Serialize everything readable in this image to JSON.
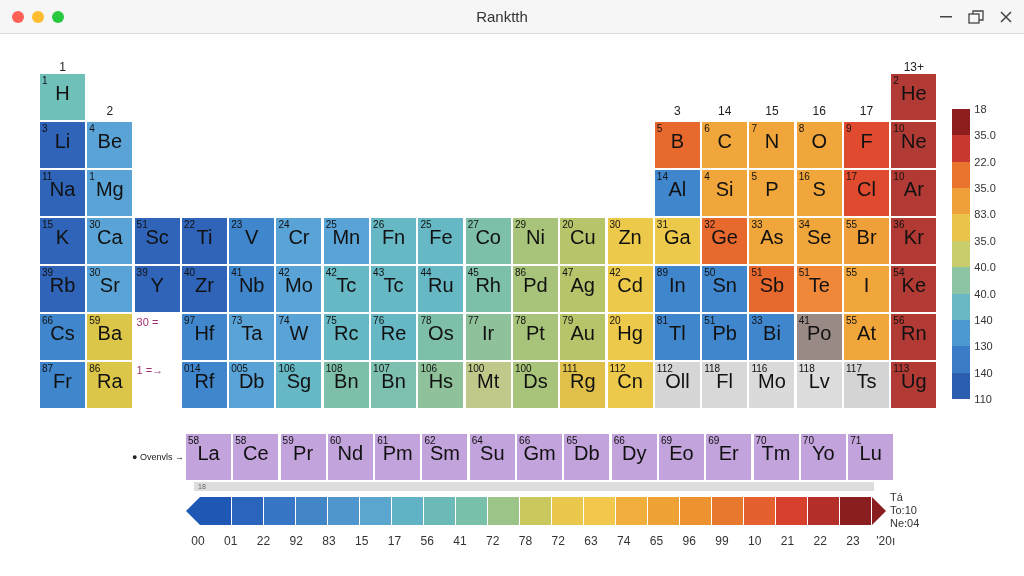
{
  "window": {
    "title": "Ranktth"
  },
  "periodic_table": {
    "header_labels": [
      {
        "kind": "label",
        "text": "1"
      },
      {
        "kind": "empty"
      },
      {
        "kind": "empty"
      },
      {
        "kind": "empty"
      },
      {
        "kind": "empty"
      },
      {
        "kind": "empty"
      },
      {
        "kind": "empty"
      },
      {
        "kind": "empty"
      },
      {
        "kind": "empty"
      },
      {
        "kind": "empty"
      },
      {
        "kind": "empty"
      },
      {
        "kind": "empty"
      },
      {
        "kind": "empty"
      },
      {
        "kind": "empty"
      },
      {
        "kind": "empty"
      },
      {
        "kind": "empty"
      },
      {
        "kind": "empty"
      },
      {
        "kind": "empty"
      },
      {
        "kind": "label",
        "text": "13+"
      }
    ],
    "rows": [
      [
        {
          "kind": "element",
          "number": "1",
          "symbol": "H",
          "color": "#6fc0b8"
        },
        {
          "kind": "label",
          "text": "2"
        },
        {
          "kind": "empty"
        },
        {
          "kind": "empty"
        },
        {
          "kind": "empty"
        },
        {
          "kind": "empty"
        },
        {
          "kind": "empty"
        },
        {
          "kind": "empty"
        },
        {
          "kind": "empty"
        },
        {
          "kind": "empty"
        },
        {
          "kind": "empty"
        },
        {
          "kind": "empty"
        },
        {
          "kind": "empty"
        },
        {
          "kind": "label",
          "text": "3"
        },
        {
          "kind": "label",
          "text": "14"
        },
        {
          "kind": "label",
          "text": "15"
        },
        {
          "kind": "label",
          "text": "16"
        },
        {
          "kind": "label",
          "text": "17"
        },
        {
          "kind": "element",
          "number": "2",
          "symbol": "He",
          "color": "#b23a35"
        }
      ],
      [
        {
          "kind": "element",
          "number": "3",
          "symbol": "Li",
          "color": "#2f64b8"
        },
        {
          "kind": "element",
          "number": "4",
          "symbol": "Be",
          "color": "#5aa3d6"
        },
        {
          "kind": "empty"
        },
        {
          "kind": "empty"
        },
        {
          "kind": "empty"
        },
        {
          "kind": "empty"
        },
        {
          "kind": "empty"
        },
        {
          "kind": "empty"
        },
        {
          "kind": "empty"
        },
        {
          "kind": "empty"
        },
        {
          "kind": "empty"
        },
        {
          "kind": "empty"
        },
        {
          "kind": "empty"
        },
        {
          "kind": "element",
          "number": "5",
          "symbol": "B",
          "color": "#e8692e"
        },
        {
          "kind": "element",
          "number": "6",
          "symbol": "C",
          "color": "#f0a63a"
        },
        {
          "kind": "element",
          "number": "7",
          "symbol": "N",
          "color": "#f0a63a"
        },
        {
          "kind": "element",
          "number": "8",
          "symbol": "O",
          "color": "#f0a63a"
        },
        {
          "kind": "element",
          "number": "9",
          "symbol": "F",
          "color": "#e04a2e"
        },
        {
          "kind": "element",
          "number": "10",
          "symbol": "Ne",
          "color": "#b23a35"
        }
      ],
      [
        {
          "kind": "element",
          "number": "11",
          "symbol": "Na",
          "color": "#2f64b8"
        },
        {
          "kind": "element",
          "number": "1",
          "symbol": "Mg",
          "color": "#5aa3d6"
        },
        {
          "kind": "empty"
        },
        {
          "kind": "empty"
        },
        {
          "kind": "empty"
        },
        {
          "kind": "empty"
        },
        {
          "kind": "empty"
        },
        {
          "kind": "empty"
        },
        {
          "kind": "empty"
        },
        {
          "kind": "empty"
        },
        {
          "kind": "empty"
        },
        {
          "kind": "empty"
        },
        {
          "kind": "empty"
        },
        {
          "kind": "element",
          "number": "14",
          "symbol": "Al",
          "color": "#3f86cc"
        },
        {
          "kind": "element",
          "number": "4",
          "symbol": "Si",
          "color": "#f0a63a"
        },
        {
          "kind": "element",
          "number": "5",
          "symbol": "P",
          "color": "#f0a63a"
        },
        {
          "kind": "element",
          "number": "16",
          "symbol": "S",
          "color": "#f0a63a"
        },
        {
          "kind": "element",
          "number": "17",
          "symbol": "Cl",
          "color": "#e04a2e"
        },
        {
          "kind": "element",
          "number": "10",
          "symbol": "Ar",
          "color": "#b23a35"
        }
      ],
      [
        {
          "kind": "element",
          "number": "15",
          "symbol": "K",
          "color": "#2f64b8"
        },
        {
          "kind": "element",
          "number": "30",
          "symbol": "Ca",
          "color": "#5aa3d6"
        },
        {
          "kind": "element",
          "number": "51",
          "symbol": "Sc",
          "color": "#2f64b8"
        },
        {
          "kind": "element",
          "number": "22",
          "symbol": "Ti",
          "color": "#2f64b8"
        },
        {
          "kind": "element",
          "number": "23",
          "symbol": "V",
          "color": "#3f86cc"
        },
        {
          "kind": "element",
          "number": "24",
          "symbol": "Cr",
          "color": "#5aa3d6"
        },
        {
          "kind": "element",
          "number": "25",
          "symbol": "Mn",
          "color": "#5aa3d6"
        },
        {
          "kind": "element",
          "number": "26",
          "symbol": "Fn",
          "color": "#66b8c4"
        },
        {
          "kind": "element",
          "number": "25",
          "symbol": "Fe",
          "color": "#66b8c4"
        },
        {
          "kind": "element",
          "number": "27",
          "symbol": "Co",
          "color": "#7dbfa8"
        },
        {
          "kind": "element",
          "number": "29",
          "symbol": "Ni",
          "color": "#a8c47a"
        },
        {
          "kind": "element",
          "number": "20",
          "symbol": "Cu",
          "color": "#b8c46a"
        },
        {
          "kind": "element",
          "number": "30",
          "symbol": "Zn",
          "color": "#ecc94b"
        },
        {
          "kind": "element",
          "number": "31",
          "symbol": "Ga",
          "color": "#ecc94b"
        },
        {
          "kind": "element",
          "number": "32",
          "symbol": "Ge",
          "color": "#e8692e"
        },
        {
          "kind": "element",
          "number": "33",
          "symbol": "As",
          "color": "#f0a63a"
        },
        {
          "kind": "element",
          "number": "34",
          "symbol": "Se",
          "color": "#f0a63a"
        },
        {
          "kind": "element",
          "number": "55",
          "symbol": "Br",
          "color": "#f0a03a"
        },
        {
          "kind": "element",
          "number": "36",
          "symbol": "Kr",
          "color": "#b23a35"
        }
      ],
      [
        {
          "kind": "element",
          "number": "39",
          "symbol": "Rb",
          "color": "#2f64b8"
        },
        {
          "kind": "element",
          "number": "30",
          "symbol": "Sr",
          "color": "#5aa3d6"
        },
        {
          "kind": "element",
          "number": "39",
          "symbol": "Y",
          "color": "#2f64b8"
        },
        {
          "kind": "element",
          "number": "40",
          "symbol": "Zr",
          "color": "#2f64b8"
        },
        {
          "kind": "element",
          "number": "41",
          "symbol": "Nb",
          "color": "#3f86cc"
        },
        {
          "kind": "element",
          "number": "42",
          "symbol": "Mo",
          "color": "#5aa3d6"
        },
        {
          "kind": "element",
          "number": "42",
          "symbol": "Tc",
          "color": "#66b8c4"
        },
        {
          "kind": "element",
          "number": "43",
          "symbol": "Tc",
          "color": "#66b8c4"
        },
        {
          "kind": "element",
          "number": "44",
          "symbol": "Ru",
          "color": "#66b8c4"
        },
        {
          "kind": "element",
          "number": "45",
          "symbol": "Rh",
          "color": "#7dbfa8"
        },
        {
          "kind": "element",
          "number": "86",
          "symbol": "Pd",
          "color": "#a8c47a"
        },
        {
          "kind": "element",
          "number": "47",
          "symbol": "Ag",
          "color": "#b8c46a"
        },
        {
          "kind": "element",
          "number": "42",
          "symbol": "Cd",
          "color": "#ecc94b"
        },
        {
          "kind": "element",
          "number": "89",
          "symbol": "In",
          "color": "#3f86cc"
        },
        {
          "kind": "element",
          "number": "50",
          "symbol": "Sn",
          "color": "#3f86cc"
        },
        {
          "kind": "element",
          "number": "51",
          "symbol": "Sb",
          "color": "#e8692e"
        },
        {
          "kind": "element",
          "number": "51",
          "symbol": "Te",
          "color": "#f0883a"
        },
        {
          "kind": "element",
          "number": "55",
          "symbol": "I",
          "color": "#f0a63a"
        },
        {
          "kind": "element",
          "number": "54",
          "symbol": "Ke",
          "color": "#b23a35"
        }
      ],
      [
        {
          "kind": "element",
          "number": "66",
          "symbol": "Cs",
          "color": "#3f86cc"
        },
        {
          "kind": "element",
          "number": "59",
          "symbol": "Ba",
          "color": "#dcc64a"
        },
        {
          "kind": "label",
          "text": "30 ="
        },
        {
          "kind": "element",
          "number": "97",
          "symbol": "Hf",
          "color": "#3f86cc"
        },
        {
          "kind": "element",
          "number": "73",
          "symbol": "Ta",
          "color": "#5aa3d6"
        },
        {
          "kind": "element",
          "number": "74",
          "symbol": "W",
          "color": "#5aa3d6"
        },
        {
          "kind": "element",
          "number": "75",
          "symbol": "Rc",
          "color": "#66b8c4"
        },
        {
          "kind": "element",
          "number": "76",
          "symbol": "Re",
          "color": "#66b8c4"
        },
        {
          "kind": "element",
          "number": "78",
          "symbol": "Os",
          "color": "#7dbfa8"
        },
        {
          "kind": "element",
          "number": "77",
          "symbol": "Ir",
          "color": "#8fc29a"
        },
        {
          "kind": "element",
          "number": "78",
          "symbol": "Pt",
          "color": "#a8c47a"
        },
        {
          "kind": "element",
          "number": "79",
          "symbol": "Au",
          "color": "#b8c46a"
        },
        {
          "kind": "element",
          "number": "20",
          "symbol": "Hg",
          "color": "#ecc94b"
        },
        {
          "kind": "element",
          "number": "81",
          "symbol": "Tl",
          "color": "#3f86cc"
        },
        {
          "kind": "element",
          "number": "51",
          "symbol": "Pb",
          "color": "#3f86cc"
        },
        {
          "kind": "element",
          "number": "33",
          "symbol": "Bi",
          "color": "#3f86cc"
        },
        {
          "kind": "element",
          "number": "41",
          "symbol": "Po",
          "color": "#9a8a86"
        },
        {
          "kind": "element",
          "number": "55",
          "symbol": "At",
          "color": "#f0a63a"
        },
        {
          "kind": "element",
          "number": "56",
          "symbol": "Rn",
          "color": "#b23a35"
        }
      ],
      [
        {
          "kind": "element",
          "number": "87",
          "symbol": "Fr",
          "color": "#3f86cc"
        },
        {
          "kind": "element",
          "number": "86",
          "symbol": "Ra",
          "color": "#dcc64a"
        },
        {
          "kind": "label",
          "text": "1 =→"
        },
        {
          "kind": "element",
          "number": "014",
          "symbol": "Rf",
          "color": "#3f86cc"
        },
        {
          "kind": "element",
          "number": "005",
          "symbol": "Db",
          "color": "#5aa3d6"
        },
        {
          "kind": "element",
          "number": "106",
          "symbol": "Sg",
          "color": "#66b8c4"
        },
        {
          "kind": "element",
          "number": "108",
          "symbol": "Bn",
          "color": "#7dbfa8"
        },
        {
          "kind": "element",
          "number": "107",
          "symbol": "Bn",
          "color": "#7dc0b0"
        },
        {
          "kind": "element",
          "number": "106",
          "symbol": "Hs",
          "color": "#8fc29a"
        },
        {
          "kind": "element",
          "number": "100",
          "symbol": "Mt",
          "color": "#c0c88a"
        },
        {
          "kind": "element",
          "number": "100",
          "symbol": "Ds",
          "color": "#a8c47a"
        },
        {
          "kind": "element",
          "number": "111",
          "symbol": "Rg",
          "color": "#e0c04a"
        },
        {
          "kind": "element",
          "number": "112",
          "symbol": "Cn",
          "color": "#ecc94b"
        },
        {
          "kind": "element",
          "number": "112",
          "symbol": "Oll",
          "color": "#d6d6d6"
        },
        {
          "kind": "element",
          "number": "118",
          "symbol": "Fl",
          "color": "#d8d8d8"
        },
        {
          "kind": "element",
          "number": "116",
          "symbol": "Mo",
          "color": "#dadada"
        },
        {
          "kind": "element",
          "number": "118",
          "symbol": "Lv",
          "color": "#dcdcdc"
        },
        {
          "kind": "element",
          "number": "117",
          "symbol": "Ts",
          "color": "#d4d4d4"
        },
        {
          "kind": "element",
          "number": "113",
          "symbol": "Ug",
          "color": "#b23a35"
        }
      ]
    ],
    "series_label": "● Ovenvls →",
    "lanthanides": [
      {
        "number": "58",
        "symbol": "La"
      },
      {
        "number": "58",
        "symbol": "Ce"
      },
      {
        "number": "59",
        "symbol": "Pr"
      },
      {
        "number": "60",
        "symbol": "Nd"
      },
      {
        "number": "61",
        "symbol": "Pm"
      },
      {
        "number": "62",
        "symbol": "Sm"
      },
      {
        "number": "64",
        "symbol": "Su"
      },
      {
        "number": "66",
        "symbol": "Gm"
      },
      {
        "number": "65",
        "symbol": "Db"
      },
      {
        "number": "66",
        "symbol": "Dy"
      },
      {
        "number": "69",
        "symbol": "Eo"
      },
      {
        "number": "69",
        "symbol": "Er"
      },
      {
        "number": "70",
        "symbol": "Tm"
      },
      {
        "number": "70",
        "symbol": "Yo"
      },
      {
        "number": "71",
        "symbol": "Lu"
      }
    ]
  },
  "side_legend": {
    "bands": [
      {
        "color": "#8e1e1e"
      },
      {
        "color": "#c8382e"
      },
      {
        "color": "#e8742e"
      },
      {
        "color": "#f0a03a"
      },
      {
        "color": "#eac44a"
      },
      {
        "color": "#c8cc6a"
      },
      {
        "color": "#8cc4a4"
      },
      {
        "color": "#6ab8c4"
      },
      {
        "color": "#4e98d2"
      },
      {
        "color": "#3a7cc6"
      },
      {
        "color": "#2c5eb0"
      }
    ],
    "ticks": [
      "18",
      "35.0",
      "22.0",
      "35.0",
      "83.0",
      "35.0",
      "40.0",
      "40.0",
      "140",
      "130",
      "140",
      "110"
    ]
  },
  "bottom_scale": {
    "bar_label": "18",
    "bands": [
      {
        "color": "#1f58b4"
      },
      {
        "color": "#2a64bc"
      },
      {
        "color": "#3676c4"
      },
      {
        "color": "#4286c8"
      },
      {
        "color": "#4e96cc"
      },
      {
        "color": "#5aa6ce"
      },
      {
        "color": "#62b2c6"
      },
      {
        "color": "#6cbab8"
      },
      {
        "color": "#78c0aa"
      },
      {
        "color": "#9cc488"
      },
      {
        "color": "#c8c85c"
      },
      {
        "color": "#eac84e"
      },
      {
        "color": "#f2c84c"
      },
      {
        "color": "#f0ae3c"
      },
      {
        "color": "#eea236"
      },
      {
        "color": "#ec9230"
      },
      {
        "color": "#e8782e"
      },
      {
        "color": "#e4602e"
      },
      {
        "color": "#d8402e"
      },
      {
        "color": "#b42e2a"
      },
      {
        "color": "#8a1e1e"
      }
    ],
    "ticks": [
      "00",
      "01",
      "22",
      "92",
      "83",
      "15",
      "17",
      "56",
      "41",
      "72",
      "78",
      "72",
      "63",
      "74",
      "65",
      "96",
      "99",
      "10",
      "21",
      "22",
      "23",
      "'20ı"
    ],
    "side_labels": [
      "Tá",
      "To:10",
      "Ne:04"
    ]
  }
}
